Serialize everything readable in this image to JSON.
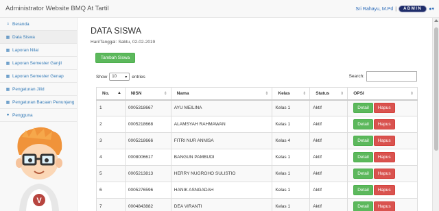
{
  "navbar": {
    "brand": "Administrator Website BMQ At Tartil",
    "user_name": "Sri Rahayu, M.Pd",
    "separator": "|",
    "role_badge": "ADMIN"
  },
  "sidebar": {
    "items": [
      {
        "label": "Beranda",
        "icon": "home-icon",
        "glyph": "⌂"
      },
      {
        "label": "Data Siswa",
        "icon": "table-icon",
        "glyph": "▦"
      },
      {
        "label": "Laporan Nilai",
        "icon": "table-icon",
        "glyph": "▦"
      },
      {
        "label": "Laporan Semester Ganjil",
        "icon": "table-icon",
        "glyph": "▦"
      },
      {
        "label": "Laporan Semester Genap",
        "icon": "table-icon",
        "glyph": "▦"
      },
      {
        "label": "Pengaturan Jilid",
        "icon": "table-icon",
        "glyph": "▦"
      },
      {
        "label": "Pengaturan Bacaan Penunjang",
        "icon": "table-icon",
        "glyph": "▦"
      },
      {
        "label": "Pengguna",
        "icon": "user-icon",
        "glyph": "●"
      }
    ]
  },
  "main": {
    "title": "DATA SISWA",
    "date_label": "Hari/Tanggal:",
    "date_value": "Sabtu, 02-02-2019",
    "add_button": "Tambah Siswa",
    "show_label": "Show",
    "show_value": "10",
    "entries_label": "entries",
    "search_label": "Search:"
  },
  "table": {
    "headers": [
      "No.",
      "NISN",
      "Nama",
      "Kelas",
      "Status",
      "OPSI"
    ],
    "detail_label": "Detail",
    "hapus_label": "Hapus",
    "rows": [
      {
        "no": "1",
        "nisn": "0005318667",
        "nama": "AYU MEILINA",
        "kelas": "Kelas 1",
        "status": "Aktif"
      },
      {
        "no": "2",
        "nisn": "0005218668",
        "nama": "ALAMSYAH RAHMAWAN",
        "kelas": "Kelas 1",
        "status": "Aktif"
      },
      {
        "no": "3",
        "nisn": "0005218666",
        "nama": "FITRI NUR ANNISA",
        "kelas": "Kelas 4",
        "status": "Aktif"
      },
      {
        "no": "4",
        "nisn": "0008006617",
        "nama": "BANGUN PAMBUDI",
        "kelas": "Kelas 1",
        "status": "Aktif"
      },
      {
        "no": "5",
        "nisn": "0005213813",
        "nama": "HERRY NUGROHO SULISTIO",
        "kelas": "Kelas 1",
        "status": "Aktif"
      },
      {
        "no": "6",
        "nisn": "0005276596",
        "nama": "HANIK ASNGADAH",
        "kelas": "Kelas 1",
        "status": "Aktif"
      },
      {
        "no": "7",
        "nisn": "0004843882",
        "nama": "DEA VIRANTI",
        "kelas": "Kelas 1",
        "status": "Aktif"
      }
    ]
  },
  "colors": {
    "link": "#337ab7",
    "success": "#5cb85c",
    "danger": "#d9534f",
    "badge": "#1f2d6a"
  }
}
